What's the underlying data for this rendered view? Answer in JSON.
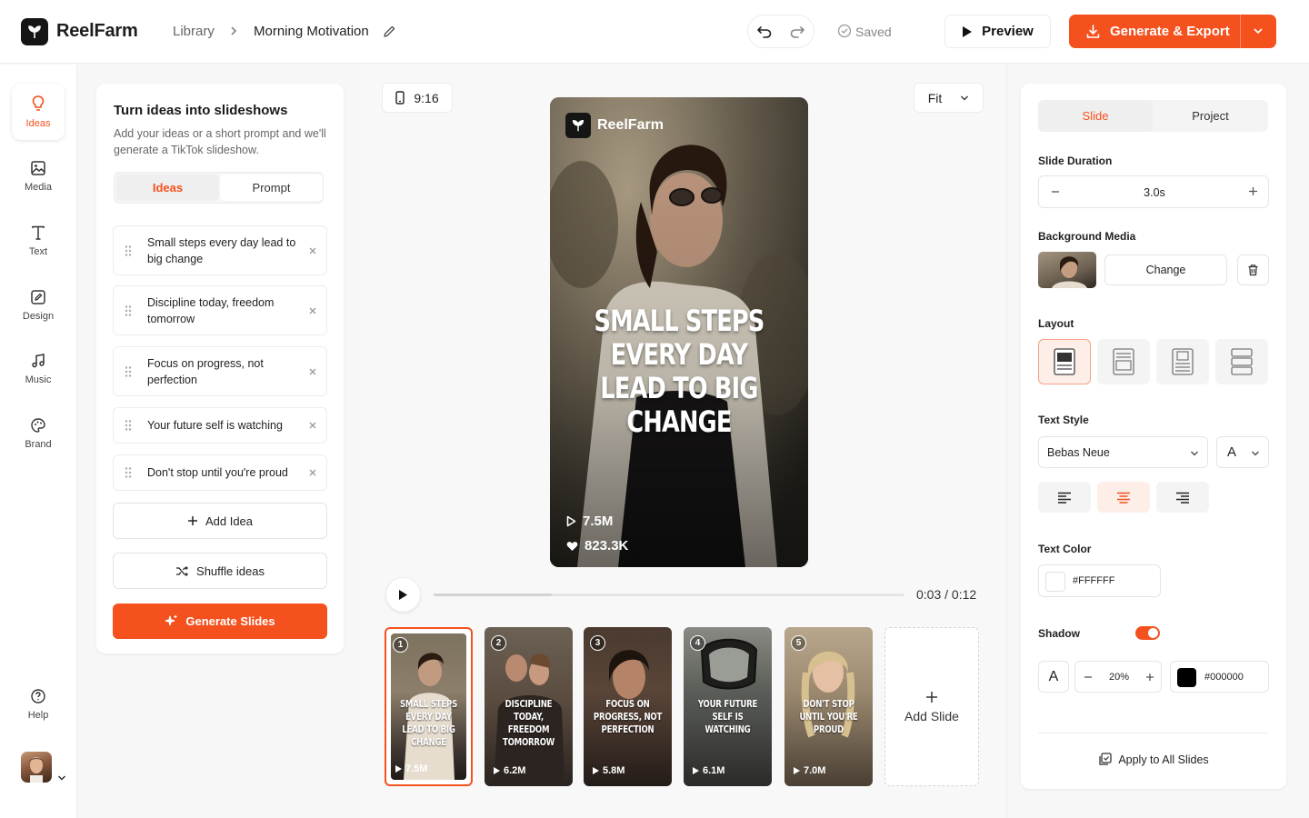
{
  "header": {
    "brand": "ReelFarm",
    "breadcrumb_library": "Library",
    "breadcrumb_current": "Morning Motivation",
    "saved_status": "Saved",
    "preview_label": "Preview",
    "generate_label": "Generate & Export"
  },
  "rail": {
    "items": [
      {
        "label": "Ideas",
        "icon": "lightbulb-icon"
      },
      {
        "label": "Media",
        "icon": "image-icon"
      },
      {
        "label": "Text",
        "icon": "text-icon"
      },
      {
        "label": "Design",
        "icon": "design-icon"
      },
      {
        "label": "Music",
        "icon": "music-icon"
      },
      {
        "label": "Brand",
        "icon": "palette-icon"
      }
    ],
    "help_label": "Help"
  },
  "ideas_panel": {
    "title": "Turn ideas into slideshows",
    "description": "Add your ideas or a short prompt and we'll generate a TikTok slideshow.",
    "tabs": [
      "Ideas",
      "Prompt"
    ],
    "active_tab": "Ideas",
    "ideas": [
      "Small steps every day lead to big change",
      "Discipline today, freedom tomorrow",
      "Focus on progress, not perfection",
      "Your future self is watching",
      "Don't stop until you're proud"
    ],
    "add_idea_label": "Add Idea",
    "shuffle_label": "Shuffle ideas",
    "generate_slides_label": "Generate Slides"
  },
  "canvas": {
    "aspect_ratio": "9:16",
    "zoom": "Fit",
    "preview_brand": "ReelFarm",
    "slide_text": "SMALL STEPS EVERY DAY LEAD TO BIG CHANGE",
    "views": "7.5M",
    "likes": "823.3K",
    "time_current": "0:03",
    "time_total": "0:12",
    "progress_fraction": 0.25
  },
  "thumbnails": [
    {
      "num": "1",
      "caption": "SMALL STEPS EVERY DAY LEAD TO BIG CHANGE",
      "views": "7.5M"
    },
    {
      "num": "2",
      "caption": "DISCIPLINE TODAY, FREEDOM TOMORROW",
      "views": "6.2M"
    },
    {
      "num": "3",
      "caption": "FOCUS ON PROGRESS, NOT PERFECTION",
      "views": "5.8M"
    },
    {
      "num": "4",
      "caption": "YOUR FUTURE SELF IS WATCHING",
      "views": "6.1M"
    },
    {
      "num": "5",
      "caption": "DON'T STOP UNTIL YOU'RE PROUD",
      "views": "7.0M"
    }
  ],
  "add_slide_label": "Add Slide",
  "settings": {
    "tabs": [
      "Slide",
      "Project"
    ],
    "active_tab": "Slide",
    "slide_duration_label": "Slide Duration",
    "slide_duration": "3.0s",
    "background_media_label": "Background Media",
    "change_label": "Change",
    "layout_label": "Layout",
    "text_style_label": "Text Style",
    "font": "Bebas Neue",
    "text_case_glyph": "A",
    "text_color_label": "Text Color",
    "text_color": "#FFFFFF",
    "shadow_label": "Shadow",
    "shadow_enabled": true,
    "shadow_glyph": "A",
    "shadow_opacity": "20%",
    "shadow_color": "#000000",
    "apply_all_label": "Apply to All Slides"
  },
  "colors": {
    "accent": "#f4511e",
    "accent_soft": "#fdeee8"
  }
}
